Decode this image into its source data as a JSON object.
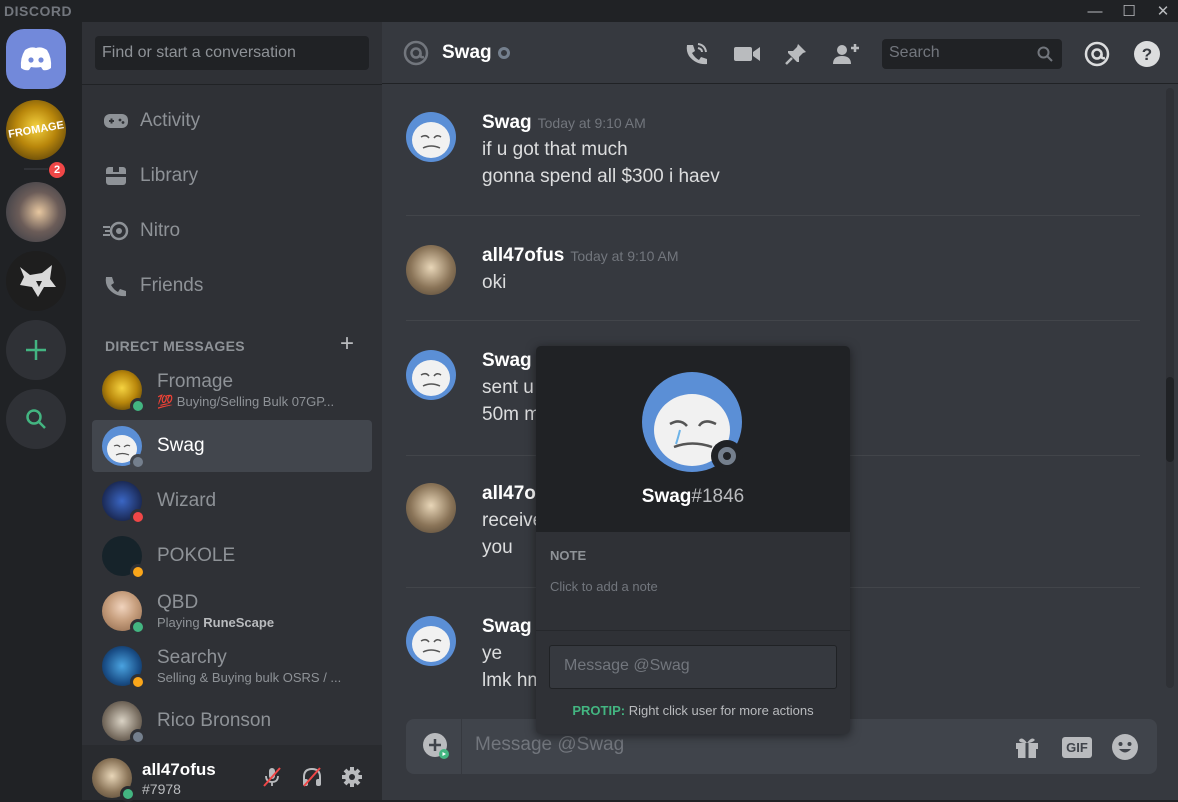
{
  "window": {
    "brand": "DISCORD",
    "minimize": "—",
    "maximize": "☐",
    "close": "✕"
  },
  "servers": {
    "unread_badge": "2",
    "colors": {
      "home": "#7289da",
      "add": "#43b581",
      "explore": "#43b581"
    }
  },
  "sidebar": {
    "search_placeholder": "Find or start a conversation",
    "nav": [
      {
        "label": "Activity",
        "icon": "gamepad-icon"
      },
      {
        "label": "Library",
        "icon": "library-icon"
      },
      {
        "label": "Nitro",
        "icon": "nitro-icon"
      },
      {
        "label": "Friends",
        "icon": "friends-icon"
      }
    ],
    "dm_header": "DIRECT MESSAGES",
    "dm_add": "+",
    "dms": [
      {
        "name": "Fromage",
        "status_text": "💯 Buying/Selling Bulk 07GP...",
        "status": "online"
      },
      {
        "name": "Swag",
        "status_text": "",
        "status": "offline"
      },
      {
        "name": "Wizard",
        "status_text": "",
        "status": "dnd"
      },
      {
        "name": "POKOLE",
        "status_text": "",
        "status": "idle"
      },
      {
        "name": "QBD",
        "status_prefix": "Playing ",
        "status_game": "RuneScape",
        "status": "online"
      },
      {
        "name": "Searchy",
        "status_text": "Selling & Buying bulk OSRS / ...",
        "status": "idle"
      },
      {
        "name": "Rico Bronson",
        "status_text": "",
        "status": "offline"
      }
    ],
    "user": {
      "name": "all47ofus",
      "tag": "#7978"
    }
  },
  "header": {
    "channel_name": "Swag",
    "search_placeholder": "Search"
  },
  "messages": [
    {
      "author": "Swag",
      "timestamp": "Today at 9:10 AM",
      "lines": [
        "if u got that much",
        "gonna spend all $300 i haev"
      ]
    },
    {
      "author": "all47ofus",
      "timestamp": "Today at 9:10 AM",
      "lines": [
        "oki"
      ]
    },
    {
      "author": "Swag",
      "timestamp": "",
      "lines": [
        "sent u",
        "50m m"
      ]
    },
    {
      "author": "all47of",
      "timestamp": "",
      "lines": [
        "receive",
        "you"
      ]
    },
    {
      "author": "Swag",
      "timestamp": "",
      "lines": [
        "ye",
        "lmk hm"
      ]
    }
  ],
  "composer": {
    "placeholder": "Message @Swag",
    "gif": "GIF"
  },
  "popout": {
    "username": "Swag",
    "discriminator": "#1846",
    "note_header": "NOTE",
    "note_placeholder": "Click to add a note",
    "message_placeholder": "Message @Swag",
    "protip_label": "PROTIP:",
    "protip_text": " Right click user for more actions"
  },
  "status_colors": {
    "online": "#43b581",
    "idle": "#faa61a",
    "dnd": "#f04747",
    "offline": "#747f8d"
  }
}
